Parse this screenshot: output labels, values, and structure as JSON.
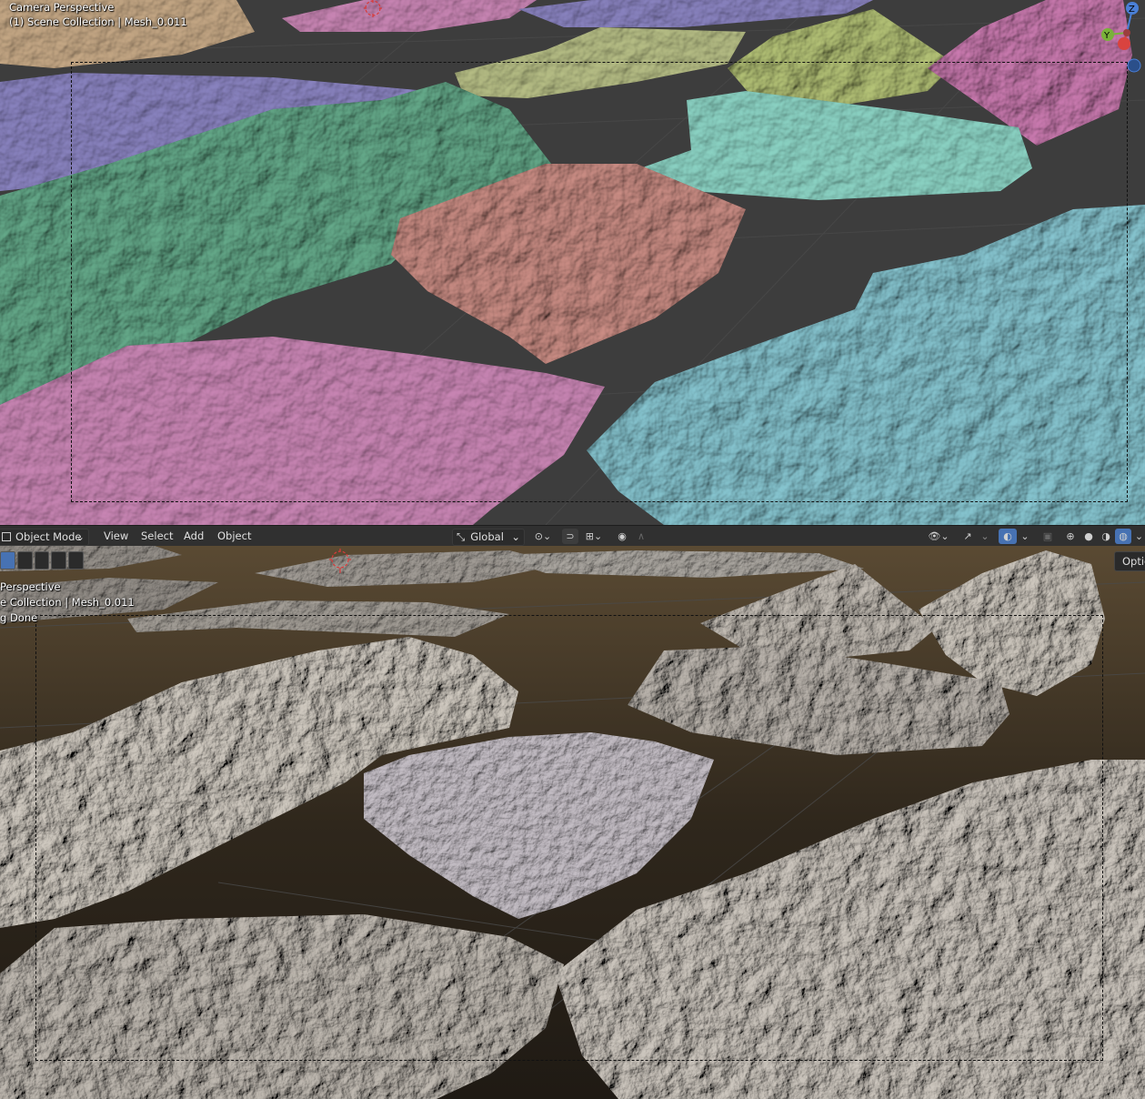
{
  "top_viewport": {
    "title": "Camera Perspective",
    "collection_line": "(1) Scene Collection | Mesh_0.011"
  },
  "header": {
    "mode_label": "Object Mode",
    "menus": [
      "View",
      "Select",
      "Add",
      "Object"
    ],
    "orientation_label": "Global"
  },
  "bottom_viewport": {
    "title_partial": "Perspective",
    "collection_partial": "e Collection | Mesh_0.011",
    "status_partial": "g Done",
    "options_label": "Optic"
  },
  "gizmo": {
    "z_label": "Z",
    "y_label": "Y"
  },
  "colors": {
    "viewport_bg": "#3d3d3d",
    "header_bg": "#303030",
    "accent": "#4772b3",
    "mesh_green": "#5b9a7d",
    "mesh_pink": "#b87aa5",
    "mesh_salmon": "#b88078",
    "mesh_cyan": "#7ab3bd",
    "mesh_purple": "#7e78b0",
    "mesh_olive": "#a7ae7a"
  }
}
